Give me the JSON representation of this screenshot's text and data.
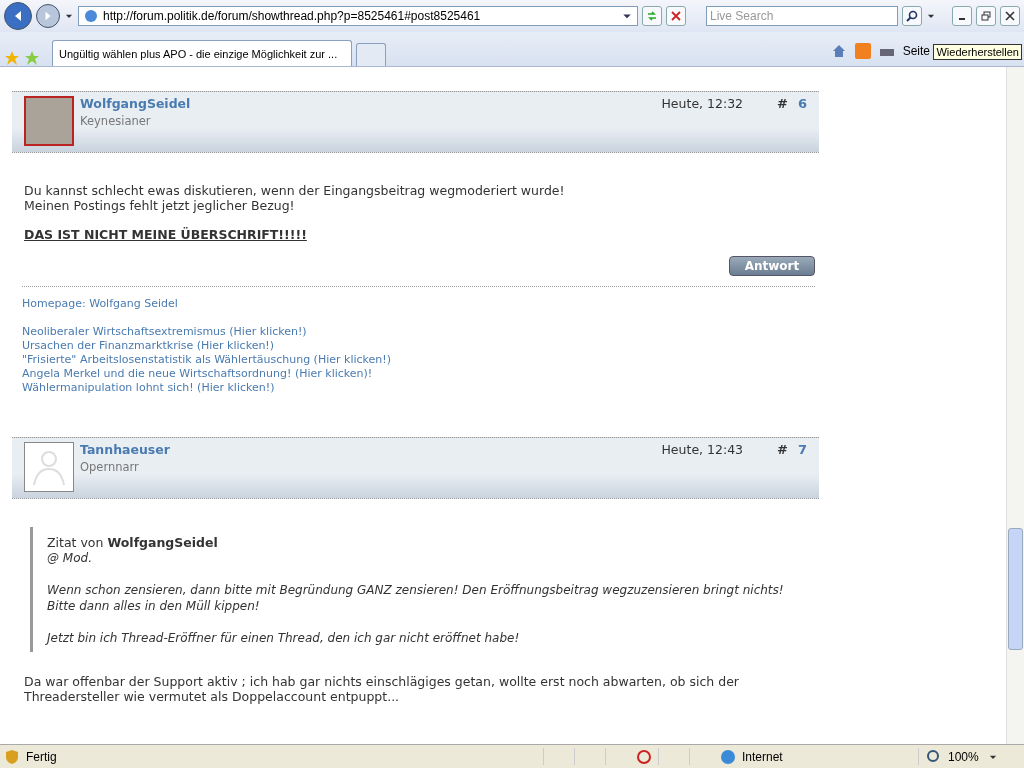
{
  "browser": {
    "address": "http://forum.politik.de/forum/showthread.php?p=8525461#post8525461",
    "search_placeholder": "Live Search",
    "tab_title": "Ungültig wählen plus APO - die einzige Möglichkeit zur ...",
    "page_menu": "Seite",
    "tooltip": "Wiederherstellen"
  },
  "posts": [
    {
      "author": "WolfgangSeidel",
      "rank": "Keynesianer",
      "time": "Heute, 12:32",
      "hash": "#",
      "number": "6",
      "kind": "photo",
      "lines": [
        "Du kannst schlecht ewas diskutieren, wenn der Eingangsbeitrag wegmoderiert wurde!",
        "Meinen Postings fehlt jetzt jeglicher Bezug!"
      ],
      "heading": "DAS IST NICHT MEINE ÜBERSCHRIFT!!!!!",
      "reply": "Antwort",
      "homepage": "Homepage: Wolfgang Seidel",
      "links": [
        "Neoliberaler Wirtschaftsextremismus (Hier klicken!)",
        "Ursachen der Finanzmarktkrise (Hier klicken!)",
        "\"Frisierte\" Arbeitslosenstatistik als Wählertäuschung (Hier klicken!)",
        "Angela Merkel und die neue Wirtschaftsordnung! (Hier klicken)!",
        "Wählermanipulation lohnt sich! (Hier klicken!)"
      ]
    },
    {
      "author": "Tannhaeuser",
      "rank": "Opernnarr",
      "time": "Heute, 12:43",
      "hash": "#",
      "number": "7",
      "kind": "default",
      "quote": {
        "prefix": "Zitat von",
        "author": "WolfgangSeidel",
        "paragraphs": [
          [
            "@ Mod."
          ],
          [
            "Wenn schon zensieren, dann bitte mit Begründung GANZ zensieren! Den Eröffnungsbeitrag wegzuzensieren bringt nichts!",
            "Bitte dann alles in den Müll kippen!"
          ],
          [
            "Jetzt bin ich Thread-Eröffner für einen Thread, den ich gar nicht eröffnet habe!"
          ]
        ]
      },
      "lines": [
        "Da war offenbar der Support aktiv ; ich hab gar nichts einschlägiges getan, wollte erst noch abwarten, ob sich der",
        "Threadersteller wie vermutet als Doppelaccount entpuppt..."
      ]
    }
  ],
  "status": {
    "text": "Fertig",
    "zone": "Internet",
    "zoom": "100%"
  }
}
